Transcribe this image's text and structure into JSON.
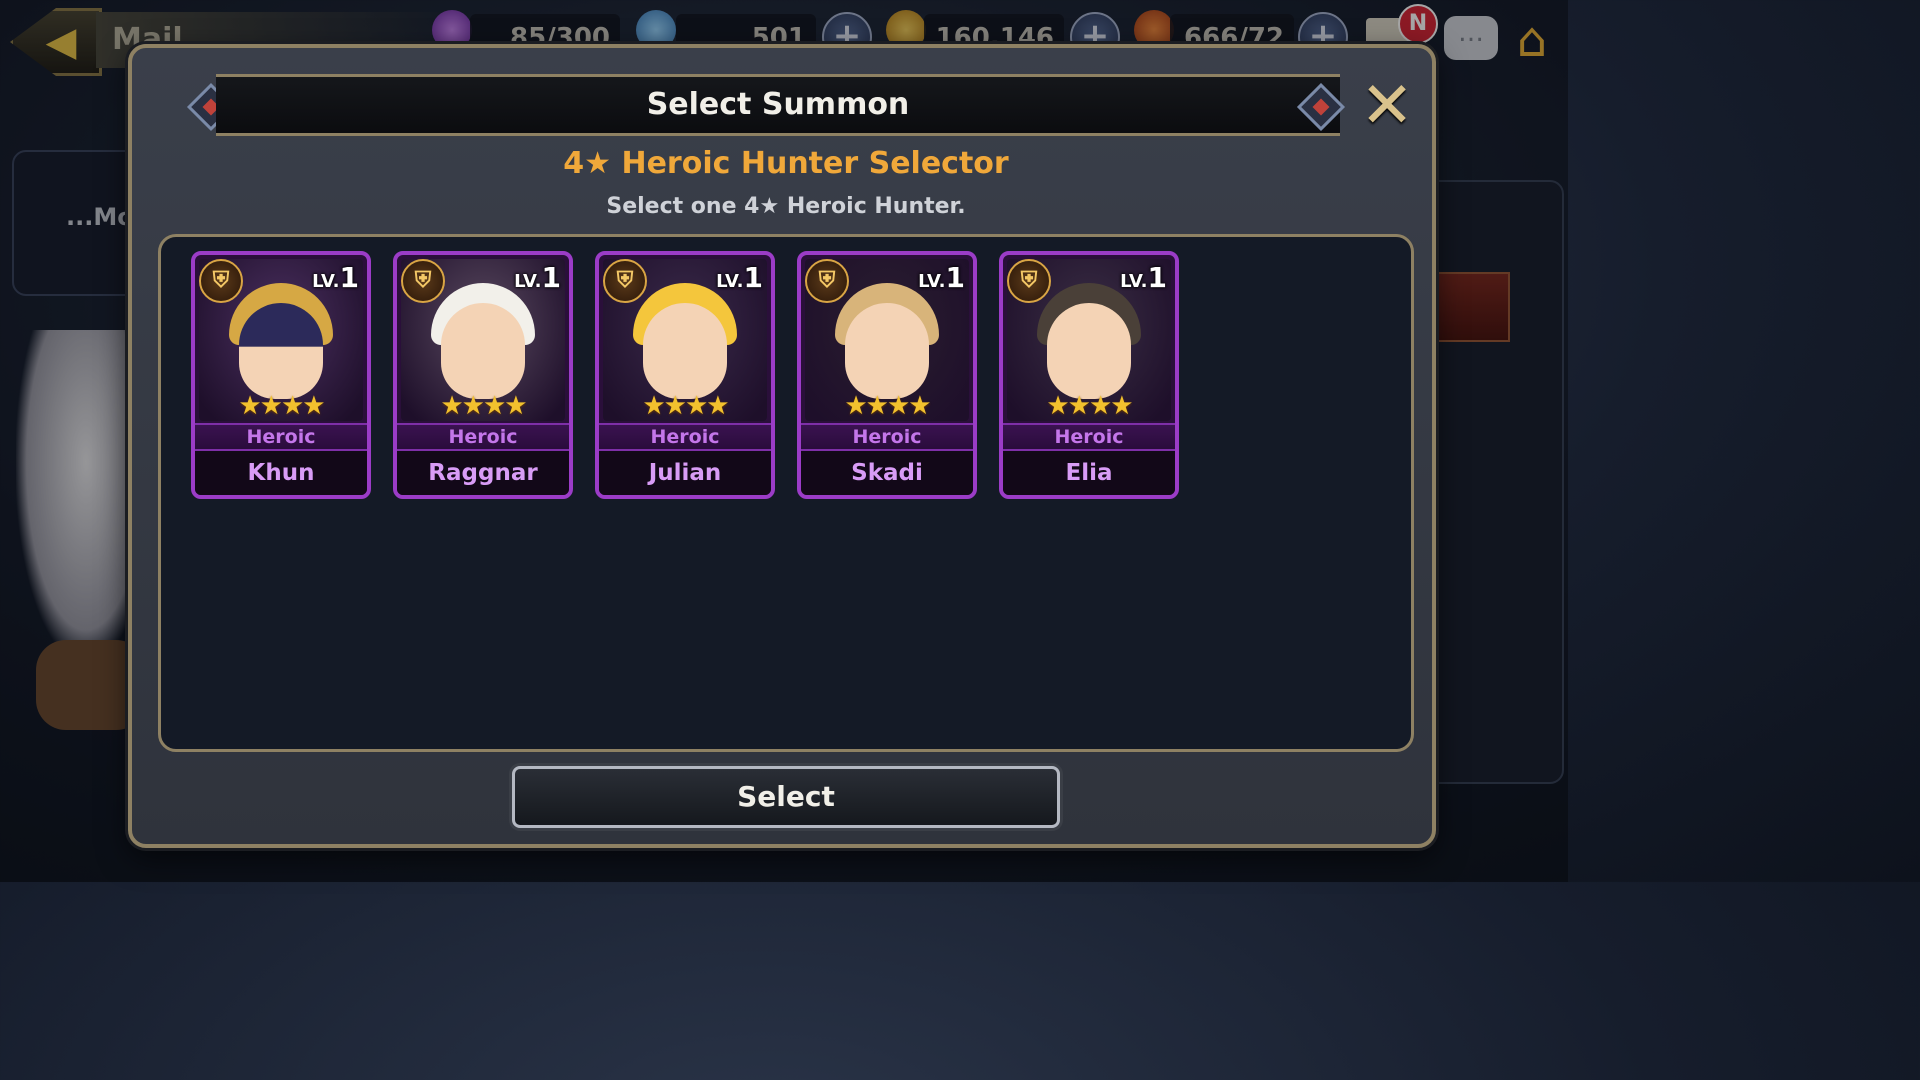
{
  "topbar": {
    "back_icon": "back-arrow-icon",
    "page_title": "Mail",
    "stamina": "85/300",
    "gems": "501",
    "gold": "160,146",
    "food": "666/72",
    "mail_badge": "N"
  },
  "background": {
    "side_panel_text": "...Mo"
  },
  "modal": {
    "title": "Select Summon",
    "selector_title": "4★ Heroic Hunter Selector",
    "selector_subtitle": "Select one 4★ Heroic Hunter.",
    "select_label": "Select",
    "hunters": [
      {
        "name": "Khun",
        "rarity": "Heroic",
        "level_prefix": "LV.",
        "level": "1",
        "stars": "★★★★",
        "hair": "#d6a844",
        "bg": "#4b3060",
        "mask": true
      },
      {
        "name": "Raggnar",
        "rarity": "Heroic",
        "level_prefix": "LV.",
        "level": "1",
        "stars": "★★★★",
        "hair": "#f2f0ea",
        "bg": "#5a4a60",
        "mask": false
      },
      {
        "name": "Julian",
        "rarity": "Heroic",
        "level_prefix": "LV.",
        "level": "1",
        "stars": "★★★★",
        "hair": "#f4c63c",
        "bg": "#3a2a4a",
        "mask": false
      },
      {
        "name": "Skadi",
        "rarity": "Heroic",
        "level_prefix": "LV.",
        "level": "1",
        "stars": "★★★★",
        "hair": "#d8b47a",
        "bg": "#2a1e30",
        "mask": false
      },
      {
        "name": "Elia",
        "rarity": "Heroic",
        "level_prefix": "LV.",
        "level": "1",
        "stars": "★★★★",
        "hair": "#4a4038",
        "bg": "#3a2e44",
        "mask": false
      }
    ]
  },
  "colors": {
    "accent_gold": "#f0a83a",
    "card_border": "#9b3cc7",
    "name_color": "#d89cf6"
  }
}
